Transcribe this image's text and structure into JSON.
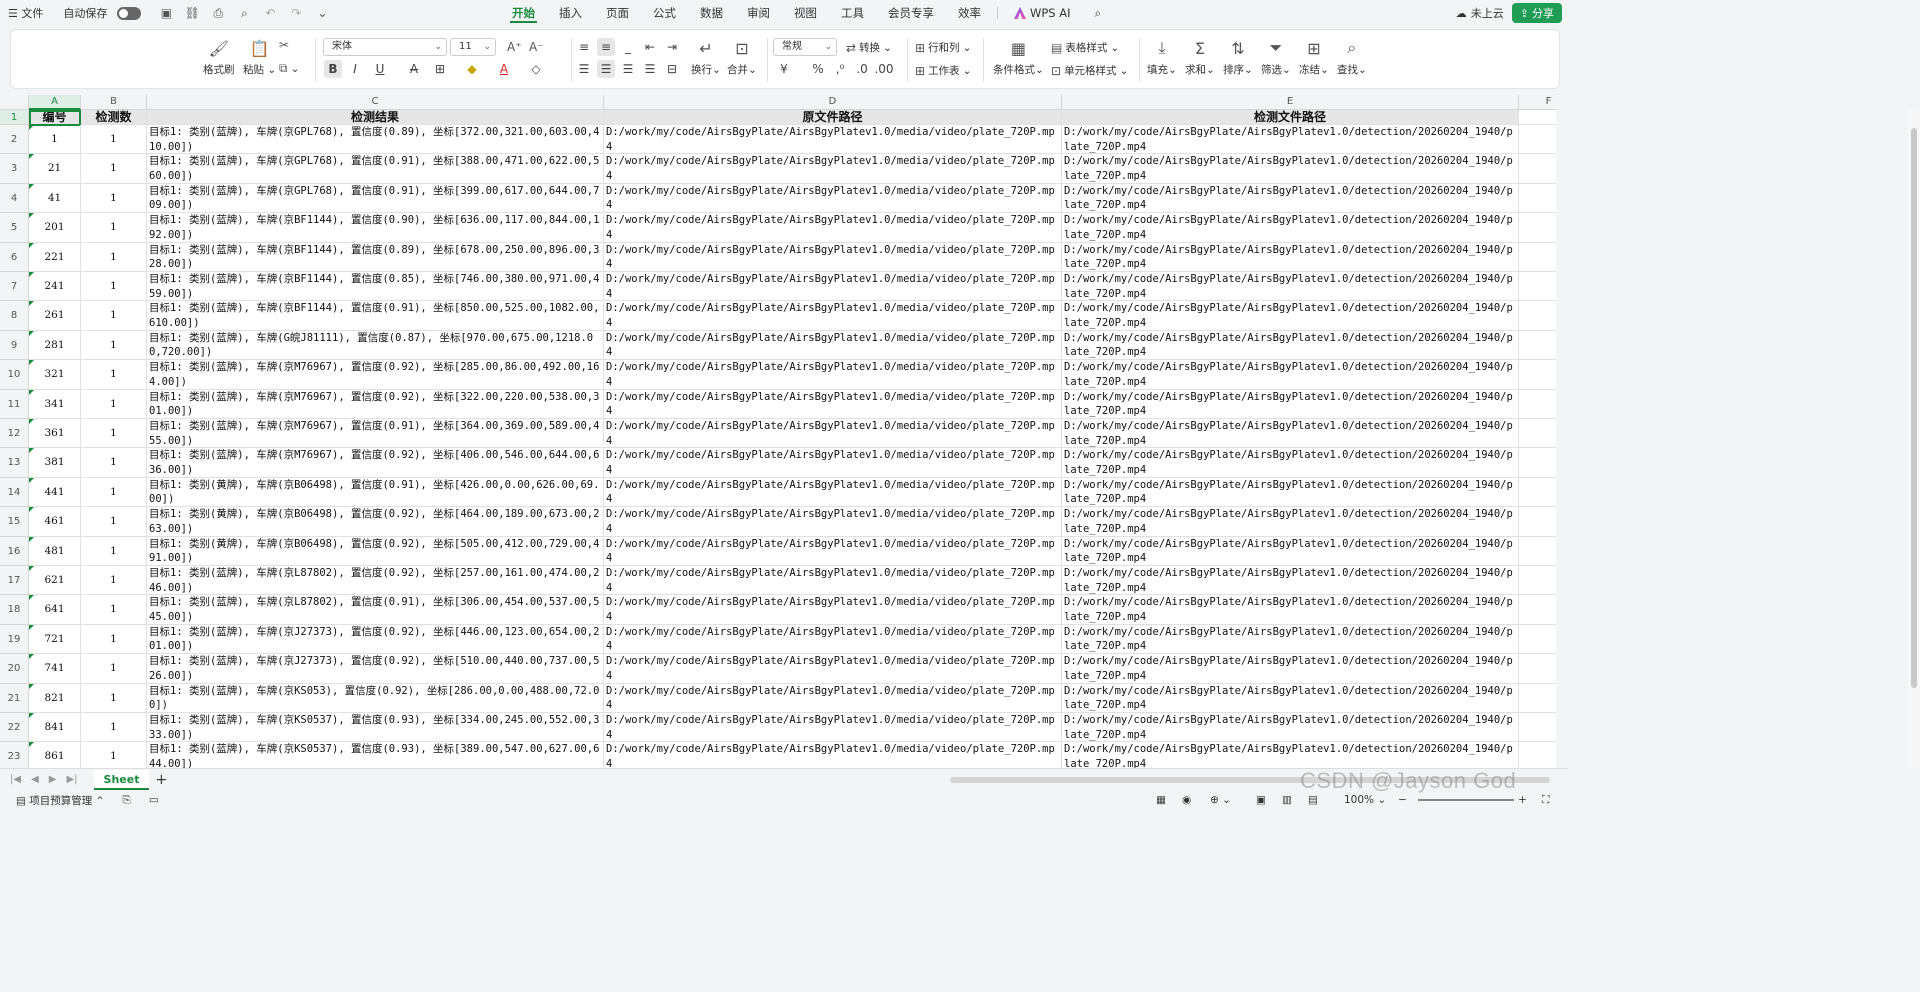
{
  "menu": {
    "file": "文件",
    "autosave": "自动保存",
    "tabs": [
      "开始",
      "插入",
      "页面",
      "公式",
      "数据",
      "审阅",
      "视图",
      "工具",
      "会员专享",
      "效率"
    ],
    "wps_ai": "WPS AI",
    "cloud": "未上云",
    "share": "分享"
  },
  "ribbon": {
    "format_painter": "格式刷",
    "paste": "粘贴",
    "font_name": "宋体",
    "font_size": "11",
    "wrap": "换行",
    "merge": "合并",
    "number_format": "常规",
    "convert": "转换",
    "row_col": "行和列",
    "worksheet": "工作表",
    "cond_format": "条件格式",
    "table_style": "表格样式",
    "cell_style": "单元格样式",
    "fill": "填充",
    "sum": "求和",
    "sort": "排序",
    "filter": "筛选",
    "freeze": "冻结",
    "find": "查找"
  },
  "columns": [
    "A",
    "B",
    "C",
    "D",
    "E",
    "F"
  ],
  "headers": [
    "编号",
    "检测数",
    "检测结果",
    "原文件路径",
    "检测文件路径"
  ],
  "rows": [
    {
      "n": "2",
      "id": "1",
      "count": "1",
      "result": "目标1: 类别(蓝牌), 车牌(京GPL768), 置信度(0.89), 坐标[372.00,321.00,603.00,410.00])",
      "src": "D:/work/my/code/AirsBgyPlate/AirsBgyPlatev1.0/media/video/plate_720P.mp4",
      "det": "D:/work/my/code/AirsBgyPlate/AirsBgyPlatev1.0/detection/20260204_1940/plate_720P.mp4"
    },
    {
      "n": "3",
      "id": "21",
      "count": "1",
      "result": "目标1: 类别(蓝牌), 车牌(京GPL768), 置信度(0.91), 坐标[388.00,471.00,622.00,560.00])",
      "src": "D:/work/my/code/AirsBgyPlate/AirsBgyPlatev1.0/media/video/plate_720P.mp4",
      "det": "D:/work/my/code/AirsBgyPlate/AirsBgyPlatev1.0/detection/20260204_1940/plate_720P.mp4"
    },
    {
      "n": "4",
      "id": "41",
      "count": "1",
      "result": "目标1: 类别(蓝牌), 车牌(京GPL768), 置信度(0.91), 坐标[399.00,617.00,644.00,709.00])",
      "src": "D:/work/my/code/AirsBgyPlate/AirsBgyPlatev1.0/media/video/plate_720P.mp4",
      "det": "D:/work/my/code/AirsBgyPlate/AirsBgyPlatev1.0/detection/20260204_1940/plate_720P.mp4"
    },
    {
      "n": "5",
      "id": "201",
      "count": "1",
      "result": "目标1: 类别(蓝牌), 车牌(京BF1144), 置信度(0.90), 坐标[636.00,117.00,844.00,192.00])",
      "src": "D:/work/my/code/AirsBgyPlate/AirsBgyPlatev1.0/media/video/plate_720P.mp4",
      "det": "D:/work/my/code/AirsBgyPlate/AirsBgyPlatev1.0/detection/20260204_1940/plate_720P.mp4"
    },
    {
      "n": "6",
      "id": "221",
      "count": "1",
      "result": "目标1: 类别(蓝牌), 车牌(京BF1144), 置信度(0.89), 坐标[678.00,250.00,896.00,328.00])",
      "src": "D:/work/my/code/AirsBgyPlate/AirsBgyPlatev1.0/media/video/plate_720P.mp4",
      "det": "D:/work/my/code/AirsBgyPlate/AirsBgyPlatev1.0/detection/20260204_1940/plate_720P.mp4"
    },
    {
      "n": "7",
      "id": "241",
      "count": "1",
      "result": "目标1: 类别(蓝牌), 车牌(京BF1144), 置信度(0.85), 坐标[746.00,380.00,971.00,459.00])",
      "src": "D:/work/my/code/AirsBgyPlate/AirsBgyPlatev1.0/media/video/plate_720P.mp4",
      "det": "D:/work/my/code/AirsBgyPlate/AirsBgyPlatev1.0/detection/20260204_1940/plate_720P.mp4"
    },
    {
      "n": "8",
      "id": "261",
      "count": "1",
      "result": "目标1: 类别(蓝牌), 车牌(京BF1144), 置信度(0.91), 坐标[850.00,525.00,1082.00,610.00])",
      "src": "D:/work/my/code/AirsBgyPlate/AirsBgyPlatev1.0/media/video/plate_720P.mp4",
      "det": "D:/work/my/code/AirsBgyPlate/AirsBgyPlatev1.0/detection/20260204_1940/plate_720P.mp4"
    },
    {
      "n": "9",
      "id": "281",
      "count": "1",
      "result": "目标1: 类别(蓝牌), 车牌(G皖J81111), 置信度(0.87), 坐标[970.00,675.00,1218.00,720.00])",
      "src": "D:/work/my/code/AirsBgyPlate/AirsBgyPlatev1.0/media/video/plate_720P.mp4",
      "det": "D:/work/my/code/AirsBgyPlate/AirsBgyPlatev1.0/detection/20260204_1940/plate_720P.mp4"
    },
    {
      "n": "10",
      "id": "321",
      "count": "1",
      "result": "目标1: 类别(蓝牌), 车牌(京M76967), 置信度(0.92), 坐标[285.00,86.00,492.00,164.00])",
      "src": "D:/work/my/code/AirsBgyPlate/AirsBgyPlatev1.0/media/video/plate_720P.mp4",
      "det": "D:/work/my/code/AirsBgyPlate/AirsBgyPlatev1.0/detection/20260204_1940/plate_720P.mp4"
    },
    {
      "n": "11",
      "id": "341",
      "count": "1",
      "result": "目标1: 类别(蓝牌), 车牌(京M76967), 置信度(0.92), 坐标[322.00,220.00,538.00,301.00])",
      "src": "D:/work/my/code/AirsBgyPlate/AirsBgyPlatev1.0/media/video/plate_720P.mp4",
      "det": "D:/work/my/code/AirsBgyPlate/AirsBgyPlatev1.0/detection/20260204_1940/plate_720P.mp4"
    },
    {
      "n": "12",
      "id": "361",
      "count": "1",
      "result": "目标1: 类别(蓝牌), 车牌(京M76967), 置信度(0.91), 坐标[364.00,369.00,589.00,455.00])",
      "src": "D:/work/my/code/AirsBgyPlate/AirsBgyPlatev1.0/media/video/plate_720P.mp4",
      "det": "D:/work/my/code/AirsBgyPlate/AirsBgyPlatev1.0/detection/20260204_1940/plate_720P.mp4"
    },
    {
      "n": "13",
      "id": "381",
      "count": "1",
      "result": "目标1: 类别(蓝牌), 车牌(京M76967), 置信度(0.92), 坐标[406.00,546.00,644.00,636.00])",
      "src": "D:/work/my/code/AirsBgyPlate/AirsBgyPlatev1.0/media/video/plate_720P.mp4",
      "det": "D:/work/my/code/AirsBgyPlate/AirsBgyPlatev1.0/detection/20260204_1940/plate_720P.mp4"
    },
    {
      "n": "14",
      "id": "441",
      "count": "1",
      "result": "目标1: 类别(黄牌), 车牌(京B06498), 置信度(0.91), 坐标[426.00,0.00,626.00,69.00])",
      "src": "D:/work/my/code/AirsBgyPlate/AirsBgyPlatev1.0/media/video/plate_720P.mp4",
      "det": "D:/work/my/code/AirsBgyPlate/AirsBgyPlatev1.0/detection/20260204_1940/plate_720P.mp4"
    },
    {
      "n": "15",
      "id": "461",
      "count": "1",
      "result": "目标1: 类别(黄牌), 车牌(京B06498), 置信度(0.92), 坐标[464.00,189.00,673.00,263.00])",
      "src": "D:/work/my/code/AirsBgyPlate/AirsBgyPlatev1.0/media/video/plate_720P.mp4",
      "det": "D:/work/my/code/AirsBgyPlate/AirsBgyPlatev1.0/detection/20260204_1940/plate_720P.mp4"
    },
    {
      "n": "16",
      "id": "481",
      "count": "1",
      "result": "目标1: 类别(黄牌), 车牌(京B06498), 置信度(0.92), 坐标[505.00,412.00,729.00,491.00])",
      "src": "D:/work/my/code/AirsBgyPlate/AirsBgyPlatev1.0/media/video/plate_720P.mp4",
      "det": "D:/work/my/code/AirsBgyPlate/AirsBgyPlatev1.0/detection/20260204_1940/plate_720P.mp4"
    },
    {
      "n": "17",
      "id": "621",
      "count": "1",
      "result": "目标1: 类别(蓝牌), 车牌(京L87802), 置信度(0.92), 坐标[257.00,161.00,474.00,246.00])",
      "src": "D:/work/my/code/AirsBgyPlate/AirsBgyPlatev1.0/media/video/plate_720P.mp4",
      "det": "D:/work/my/code/AirsBgyPlate/AirsBgyPlatev1.0/detection/20260204_1940/plate_720P.mp4"
    },
    {
      "n": "18",
      "id": "641",
      "count": "1",
      "result": "目标1: 类别(蓝牌), 车牌(京L87802), 置信度(0.91), 坐标[306.00,454.00,537.00,545.00])",
      "src": "D:/work/my/code/AirsBgyPlate/AirsBgyPlatev1.0/media/video/plate_720P.mp4",
      "det": "D:/work/my/code/AirsBgyPlate/AirsBgyPlatev1.0/detection/20260204_1940/plate_720P.mp4"
    },
    {
      "n": "19",
      "id": "721",
      "count": "1",
      "result": "目标1: 类别(蓝牌), 车牌(京J27373), 置信度(0.92), 坐标[446.00,123.00,654.00,201.00])",
      "src": "D:/work/my/code/AirsBgyPlate/AirsBgyPlatev1.0/media/video/plate_720P.mp4",
      "det": "D:/work/my/code/AirsBgyPlate/AirsBgyPlatev1.0/detection/20260204_1940/plate_720P.mp4"
    },
    {
      "n": "20",
      "id": "741",
      "count": "1",
      "result": "目标1: 类别(蓝牌), 车牌(京J27373), 置信度(0.92), 坐标[510.00,440.00,737.00,526.00])",
      "src": "D:/work/my/code/AirsBgyPlate/AirsBgyPlatev1.0/media/video/plate_720P.mp4",
      "det": "D:/work/my/code/AirsBgyPlate/AirsBgyPlatev1.0/detection/20260204_1940/plate_720P.mp4"
    },
    {
      "n": "21",
      "id": "821",
      "count": "1",
      "result": "目标1: 类别(蓝牌), 车牌(京KS053), 置信度(0.92), 坐标[286.00,0.00,488.00,72.00])",
      "src": "D:/work/my/code/AirsBgyPlate/AirsBgyPlatev1.0/media/video/plate_720P.mp4",
      "det": "D:/work/my/code/AirsBgyPlate/AirsBgyPlatev1.0/detection/20260204_1940/plate_720P.mp4"
    },
    {
      "n": "22",
      "id": "841",
      "count": "1",
      "result": "目标1: 类别(蓝牌), 车牌(京KS0537), 置信度(0.93), 坐标[334.00,245.00,552.00,333.00])",
      "src": "D:/work/my/code/AirsBgyPlate/AirsBgyPlatev1.0/media/video/plate_720P.mp4",
      "det": "D:/work/my/code/AirsBgyPlate/AirsBgyPlatev1.0/detection/20260204_1940/plate_720P.mp4"
    },
    {
      "n": "23",
      "id": "861",
      "count": "1",
      "result": "目标1: 类别(蓝牌), 车牌(京KS0537), 置信度(0.93), 坐标[389.00,547.00,627.00,644.00])",
      "src": "D:/work/my/code/AirsBgyPlate/AirsBgyPlatev1.0/media/video/plate_720P.mp4",
      "det": "D:/work/my/code/AirsBgyPlate/AirsBgyPlatev1.0/detection/20260204_1940/plate_720P.mp4"
    }
  ],
  "sheet_tab": "Sheet",
  "status": {
    "project": "项目预算管理",
    "zoom": "100%"
  },
  "watermark": "CSDN @Jayson God"
}
